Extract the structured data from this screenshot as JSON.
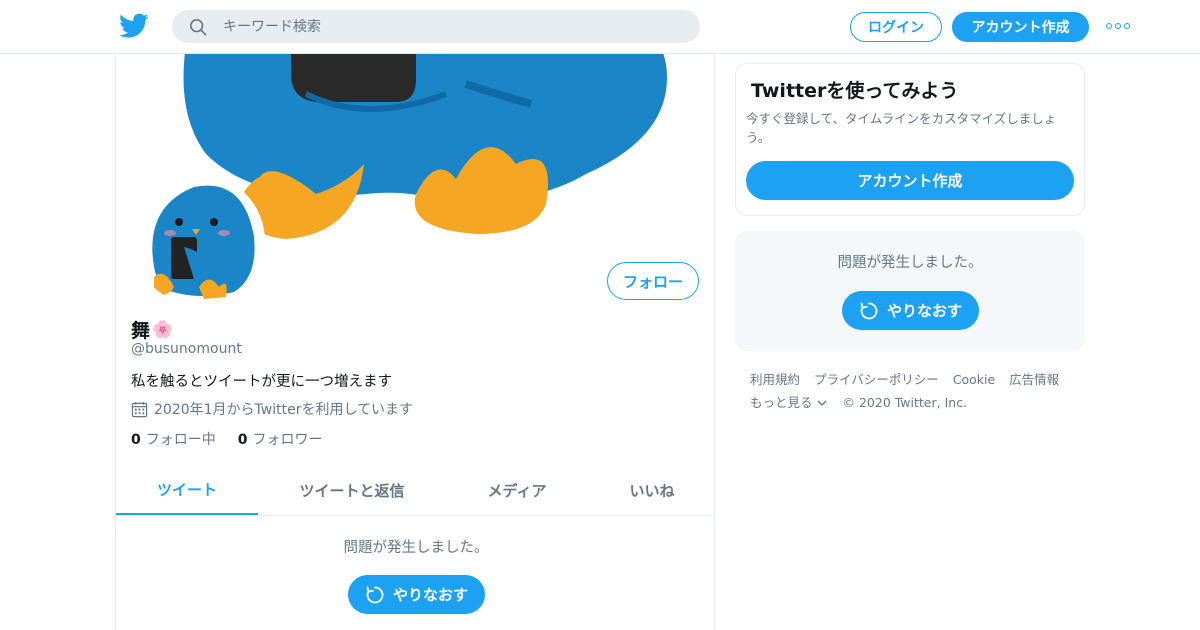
{
  "header": {
    "search_placeholder": "キーワード検索",
    "login_label": "ログイン",
    "signup_label": "アカウント作成"
  },
  "profile": {
    "name": "舞",
    "name_emoji": "🌸",
    "handle": "@busunomount",
    "bio": "私を触るとツイートが更に一つ増えます",
    "joined": "2020年1月からTwitterを利用しています",
    "following_count": "0",
    "following_label": "フォロー中",
    "followers_count": "0",
    "followers_label": "フォロワー",
    "follow_label": "フォロー"
  },
  "tabs": [
    {
      "label": "ツイート",
      "active": true
    },
    {
      "label": "ツイートと返信",
      "active": false
    },
    {
      "label": "メディア",
      "active": false
    },
    {
      "label": "いいね",
      "active": false
    }
  ],
  "timeline": {
    "error_text": "問題が発生しました。",
    "retry_label": "やりなおす"
  },
  "sidebar": {
    "signup_card": {
      "title": "Twitterを使ってみよう",
      "description": "今すぐ登録して、タイムラインをカスタマイズしましょう。",
      "button_label": "アカウント作成"
    },
    "error_card": {
      "error_text": "問題が発生しました。",
      "retry_label": "やりなおす"
    },
    "footer": {
      "links": [
        "利用規約",
        "プライバシーポリシー",
        "Cookie",
        "広告情報"
      ],
      "more_label": "もっと見る",
      "copyright": "© 2020 Twitter, Inc."
    }
  },
  "colors": {
    "accent": "#1da1f2",
    "secondary_text": "#657786",
    "border": "#e6ecf0"
  }
}
